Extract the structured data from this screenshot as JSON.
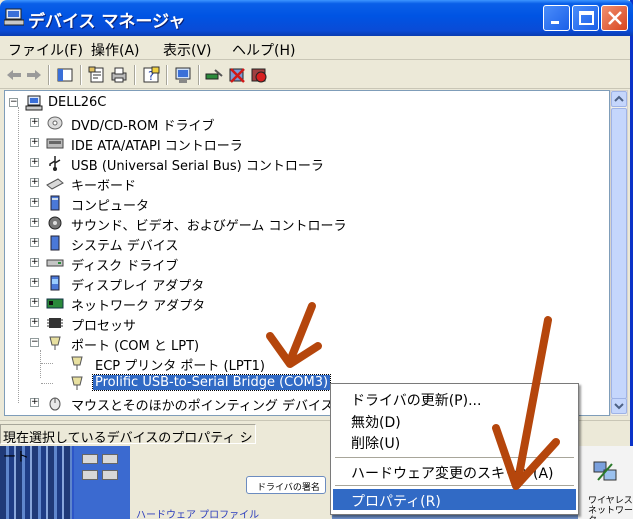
{
  "window": {
    "title": "デバイス マネージャ"
  },
  "menu": [
    "ファイル(F)",
    "操作(A)",
    "表示(V)",
    "ヘルプ(H)"
  ],
  "tree": {
    "root": "DELL26C",
    "items": [
      {
        "label": "DVD/CD-ROM ドライブ",
        "icon": "disc-drive-icon"
      },
      {
        "label": "IDE ATA/ATAPI コントローラ",
        "icon": "ide-controller-icon"
      },
      {
        "label": "USB (Universal Serial Bus) コントローラ",
        "icon": "usb-icon"
      },
      {
        "label": "キーボード",
        "icon": "keyboard-icon"
      },
      {
        "label": "コンピュータ",
        "icon": "computer-icon"
      },
      {
        "label": "サウンド、ビデオ、およびゲーム コントローラ",
        "icon": "sound-icon"
      },
      {
        "label": "システム デバイス",
        "icon": "system-device-icon"
      },
      {
        "label": "ディスク ドライブ",
        "icon": "disk-drive-icon"
      },
      {
        "label": "ディスプレイ アダプタ",
        "icon": "display-adapter-icon"
      },
      {
        "label": "ネットワーク アダプタ",
        "icon": "network-adapter-icon"
      },
      {
        "label": "プロセッサ",
        "icon": "processor-icon"
      },
      {
        "label": "ポート (COM と LPT)",
        "icon": "port-icon"
      },
      {
        "label": "ECP プリンタ ポート (LPT1)",
        "icon": "port-icon"
      },
      {
        "label": "Prolific USB-to-Serial Bridge (COM3)",
        "icon": "port-icon"
      },
      {
        "label": "マウスとそのほかのポインティング デバイス",
        "icon": "mouse-icon"
      }
    ]
  },
  "status": "現在選択しているデバイスのプロパティ シート",
  "context_menu": [
    {
      "label": "ドライバの更新(P)..."
    },
    {
      "label": "無効(D)"
    },
    {
      "label": "削除(U)"
    },
    {
      "label": "ハードウェア変更のスキャン(A)"
    },
    {
      "label": "プロパティ(R)"
    }
  ],
  "desktop": {
    "button_text": "ドライバの署名",
    "blue_text": "ハードウェア プロファイル",
    "right_text_1": "ワイヤレス",
    "right_text_2": "ネットワーク"
  },
  "colors": {
    "selection": "#316ac5",
    "arrow": "#b5460c",
    "titlebar": "#0054e3"
  }
}
